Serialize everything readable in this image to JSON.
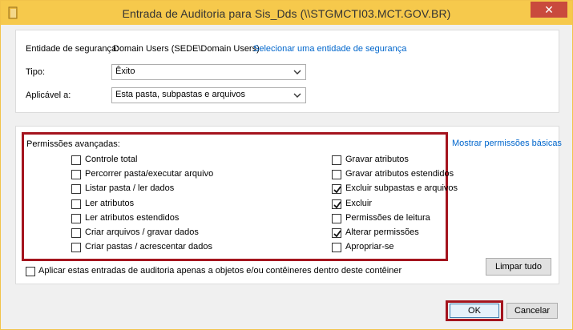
{
  "window": {
    "title": "Entrada de Auditoria para Sis_Dds (\\\\STGMCTI03.MCT.GOV.BR)",
    "close_symbol": "✕",
    "titlebar_color": "#f6c94c",
    "icon": "folder-icon"
  },
  "principal": {
    "label": "Entidade de segurança:",
    "value": "Domain Users (SEDE\\Domain Users)",
    "select_link": "Selecionar uma entidade de segurança"
  },
  "type": {
    "label": "Tipo:",
    "selected": "Êxito"
  },
  "applies_to": {
    "label": "Aplicável a:",
    "selected": "Esta pasta, subpastas e arquivos"
  },
  "permissions": {
    "title": "Permissões avançadas:",
    "show_basic_link": "Mostrar permissões básicas",
    "left": [
      {
        "label": "Controle total",
        "checked": false
      },
      {
        "label": "Percorrer pasta/executar arquivo",
        "checked": false
      },
      {
        "label": "Listar pasta / ler dados",
        "checked": false
      },
      {
        "label": "Ler atributos",
        "checked": false
      },
      {
        "label": "Ler atributos estendidos",
        "checked": false
      },
      {
        "label": "Criar arquivos / gravar dados",
        "checked": false
      },
      {
        "label": "Criar pastas / acrescentar dados",
        "checked": false
      }
    ],
    "right": [
      {
        "label": "Gravar atributos",
        "checked": false
      },
      {
        "label": "Gravar atributos estendidos",
        "checked": false
      },
      {
        "label": "Excluir subpastas e arquivos",
        "checked": true
      },
      {
        "label": "Excluir",
        "checked": true
      },
      {
        "label": "Permissões de leitura",
        "checked": false
      },
      {
        "label": "Alterar permissões",
        "checked": true
      },
      {
        "label": "Apropriar-se",
        "checked": false
      }
    ],
    "highlight_color": "#a4141e"
  },
  "apply_only": {
    "label": "Aplicar estas entradas de auditoria apenas a objetos e/ou contêineres dentro deste contêiner",
    "checked": false
  },
  "buttons": {
    "clear_all": "Limpar tudo",
    "ok": "OK",
    "cancel": "Cancelar"
  }
}
